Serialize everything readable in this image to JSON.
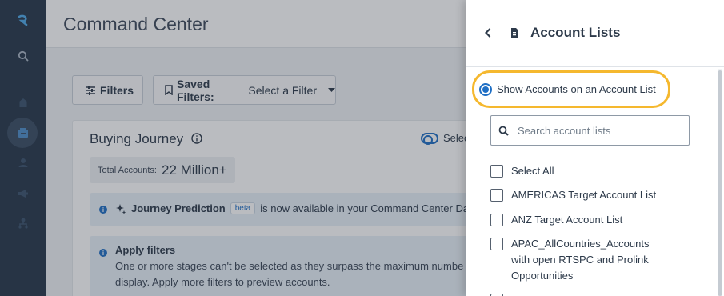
{
  "nav": {
    "items": [
      "logo-icon",
      "search-icon",
      "home-icon",
      "command-center-icon",
      "people-icon",
      "megaphone-icon",
      "org-icon"
    ],
    "active": "command-center-icon"
  },
  "header": {
    "title": "Command Center"
  },
  "toolbar": {
    "filters_label": "Filters",
    "saved_label": "Saved Filters:",
    "saved_value": " Select a Filter"
  },
  "buying_journey": {
    "title": "Buying Journey",
    "total_label": "Total Accounts:",
    "total_value": "22 Million+",
    "toggle_label": "Selec",
    "prediction_title": "Journey Prediction",
    "beta_label": "beta",
    "prediction_text": "is now available in your Command Center Das",
    "apply_title": "Apply filters",
    "apply_line1": "One or more stages can't be selected as they surpass the maximum numbe",
    "apply_line2": "display. Apply more filters to preview accounts."
  },
  "panel": {
    "title": "Account Lists",
    "radio_label": "Show Accounts on an Account List",
    "search_placeholder": "Search account lists",
    "items": [
      {
        "label": "Select All"
      },
      {
        "label": "AMERICAS Target Account List"
      },
      {
        "label": "ANZ Target Account List"
      },
      {
        "label": "APAC_AllCountries_Accounts\nwith open RTSPC and Prolink\nOpportunities"
      }
    ]
  },
  "colors": {
    "nav_bg": "#27374a",
    "accent": "#1f6fc5",
    "highlight": "#f5b82e"
  }
}
